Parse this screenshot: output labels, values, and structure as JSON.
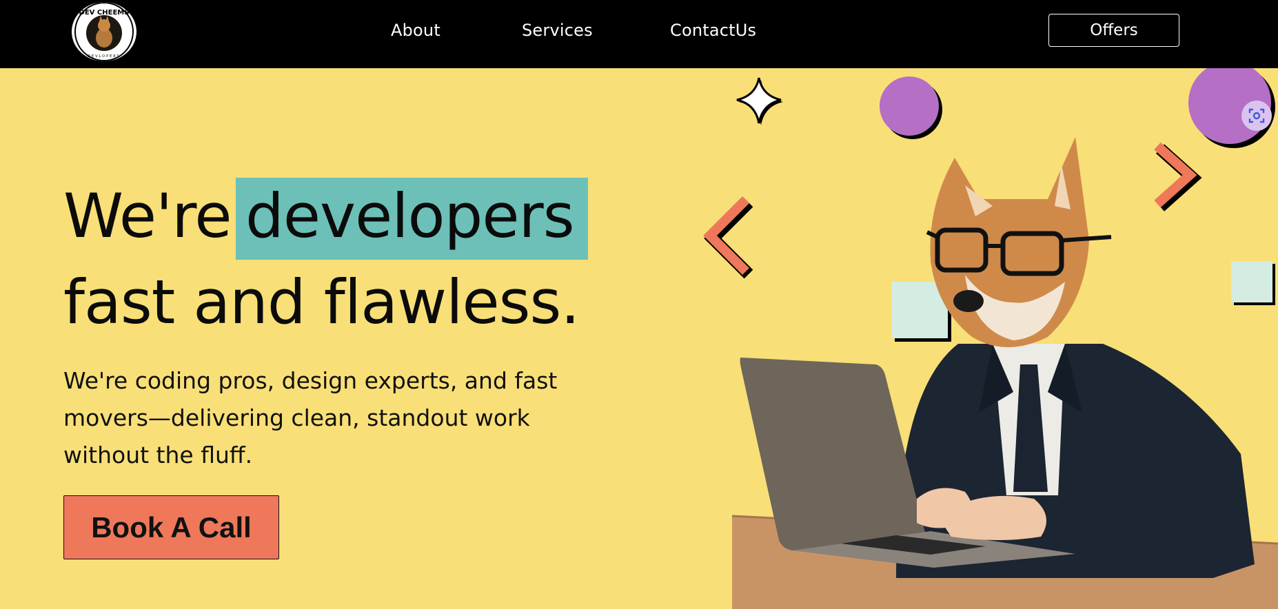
{
  "nav": {
    "logo_text": "DEV CHEEMS",
    "logo_subtext": "DEVLOPERS",
    "links": [
      "About",
      "Services",
      "ContactUs"
    ],
    "offers_label": "Offers"
  },
  "hero": {
    "line1_prefix": "We're",
    "line1_highlight": "developers",
    "line2": "fast and flawless.",
    "subtitle": "We're coding pros, design experts, and fast movers—delivering clean, standout work without the fluff.",
    "cta_label": "Book A Call"
  },
  "colors": {
    "background": "#f8df77",
    "nav_background": "#000000",
    "highlight": "#6cc0b8",
    "cta": "#ee7859",
    "accent_purple": "#b56fc5",
    "accent_mint": "#d4ece1",
    "accent_coral": "#ee7859"
  },
  "icons": {
    "decor": [
      "sparkle-icon",
      "chevron-left-icon",
      "chevron-right-icon",
      "circle-shape",
      "square-shape"
    ],
    "scan": "scan-icon"
  },
  "illustration": "shiba-developer"
}
